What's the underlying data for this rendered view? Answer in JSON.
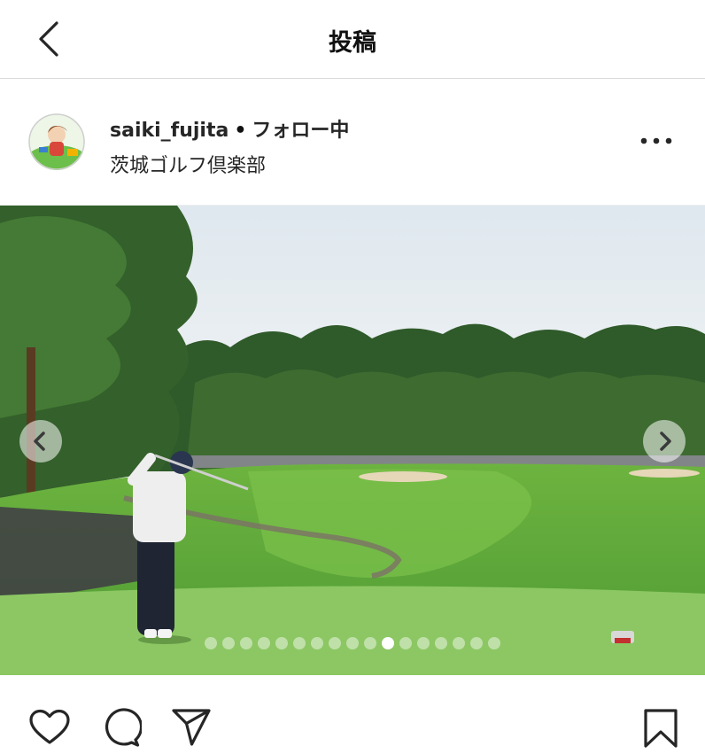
{
  "header": {
    "title": "投稿",
    "back_icon": "chevron-left-icon"
  },
  "post": {
    "username": "saiki_fujita",
    "separator": "•",
    "follow_status": "フォロー中",
    "location": "茨城ゴルフ倶楽部",
    "more_icon": "more-horizontal-icon"
  },
  "carousel": {
    "total": 17,
    "active_index": 10,
    "prev_icon": "chevron-left-icon",
    "next_icon": "chevron-right-icon"
  },
  "actions": {
    "like_icon": "heart-icon",
    "comment_icon": "comment-icon",
    "share_icon": "send-icon",
    "save_icon": "bookmark-icon"
  },
  "colors": {
    "text": "#262626",
    "divider": "#dbdbdb",
    "fairway": "#5fa33a",
    "sky": "#e8eef2"
  }
}
